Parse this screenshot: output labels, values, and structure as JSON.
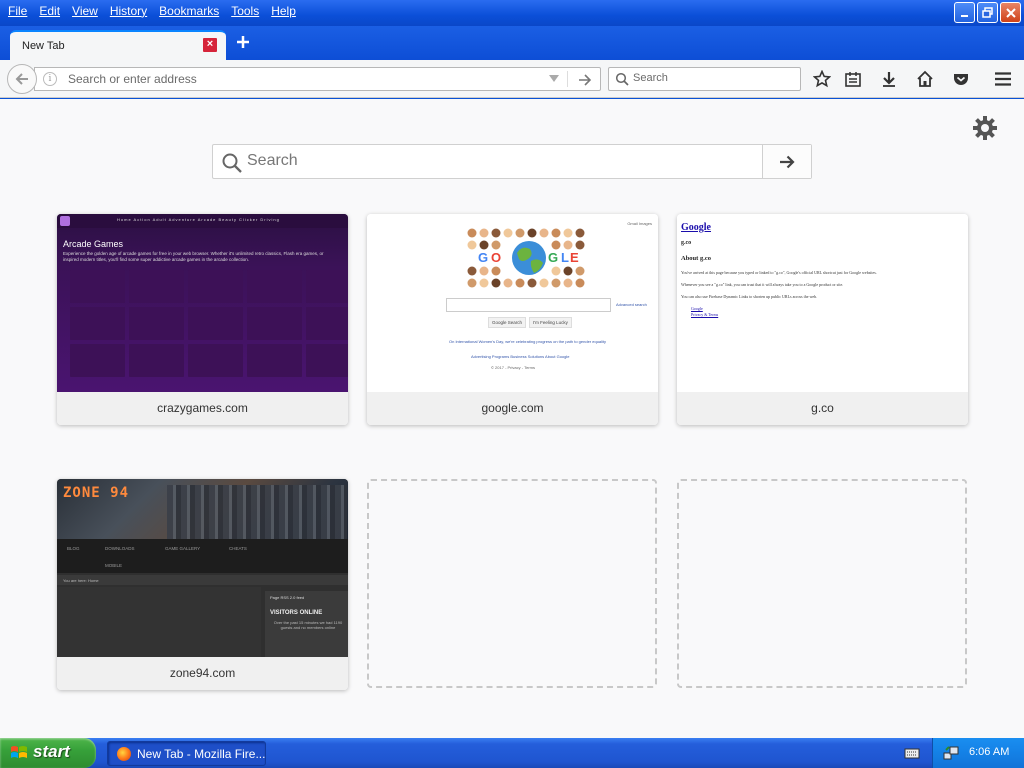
{
  "menu": [
    "File",
    "Edit",
    "View",
    "History",
    "Bookmarks",
    "Tools",
    "Help"
  ],
  "tab": {
    "title": "New Tab"
  },
  "urlbar": {
    "placeholder": "Search or enter address"
  },
  "searchbar": {
    "placeholder": "Search"
  },
  "newtab_search": {
    "placeholder": "Search"
  },
  "tiles": [
    {
      "label": "crazygames.com"
    },
    {
      "label": "google.com"
    },
    {
      "label": "g.co"
    },
    {
      "label": "zone94.com"
    }
  ],
  "thumbs": {
    "crazygames": {
      "nav": "Home  Action  Adult  Adventure  Arcade  Beauty  Clicker  Driving",
      "title": "Arcade Games",
      "desc": "Experience the golden age of arcade games for free in your web browser. Whether it's unlimited retro classics, Flash era games, or inspired modern titles, you'll find some super addictive arcade games in the arcade collection."
    },
    "google": {
      "top": "Gmail  Images",
      "btn1": "Google Search",
      "btn2": "I'm Feeling Lucky",
      "adv": "Advanced search",
      "line1": "On International Women's Day, we're celebrating progress on the path to gender equality",
      "line2": "Advertising Programs    Business Solutions    About Google",
      "line3": "© 2017 - Privacy - Terms"
    },
    "gco": {
      "heading": "Google",
      "sub": "g.co",
      "about": "About g.co",
      "p1": "You've arrived at this page because you typed or linked to \"g.co\", Google's official URL shortcut just for Google websites.",
      "p2": "Whenever you see a \"g.co\" link, you can trust that it will always take you to a Google product or site.",
      "p3": "You can also use Firebase Dynamic Links to shorten up public URLs across the web.",
      "link1": "Google",
      "link2": "Privacy & Terms"
    },
    "zone94": {
      "logo": "ZONE 94",
      "menu": [
        "BLOG",
        "DOWNLOADS",
        "GAME GALLERY",
        "CHEATS",
        "MOBILE"
      ],
      "bread": "You are here:  Home",
      "side_top": "Page RSS 2.0 feed",
      "visitors": "VISITORS ONLINE",
      "visitors_text": "Over the past 15 minutes we had 1190 guests and no members online"
    }
  },
  "taskbar": {
    "start": "start",
    "task_label": "New Tab - Mozilla Fire...",
    "clock": "6:06 AM"
  }
}
